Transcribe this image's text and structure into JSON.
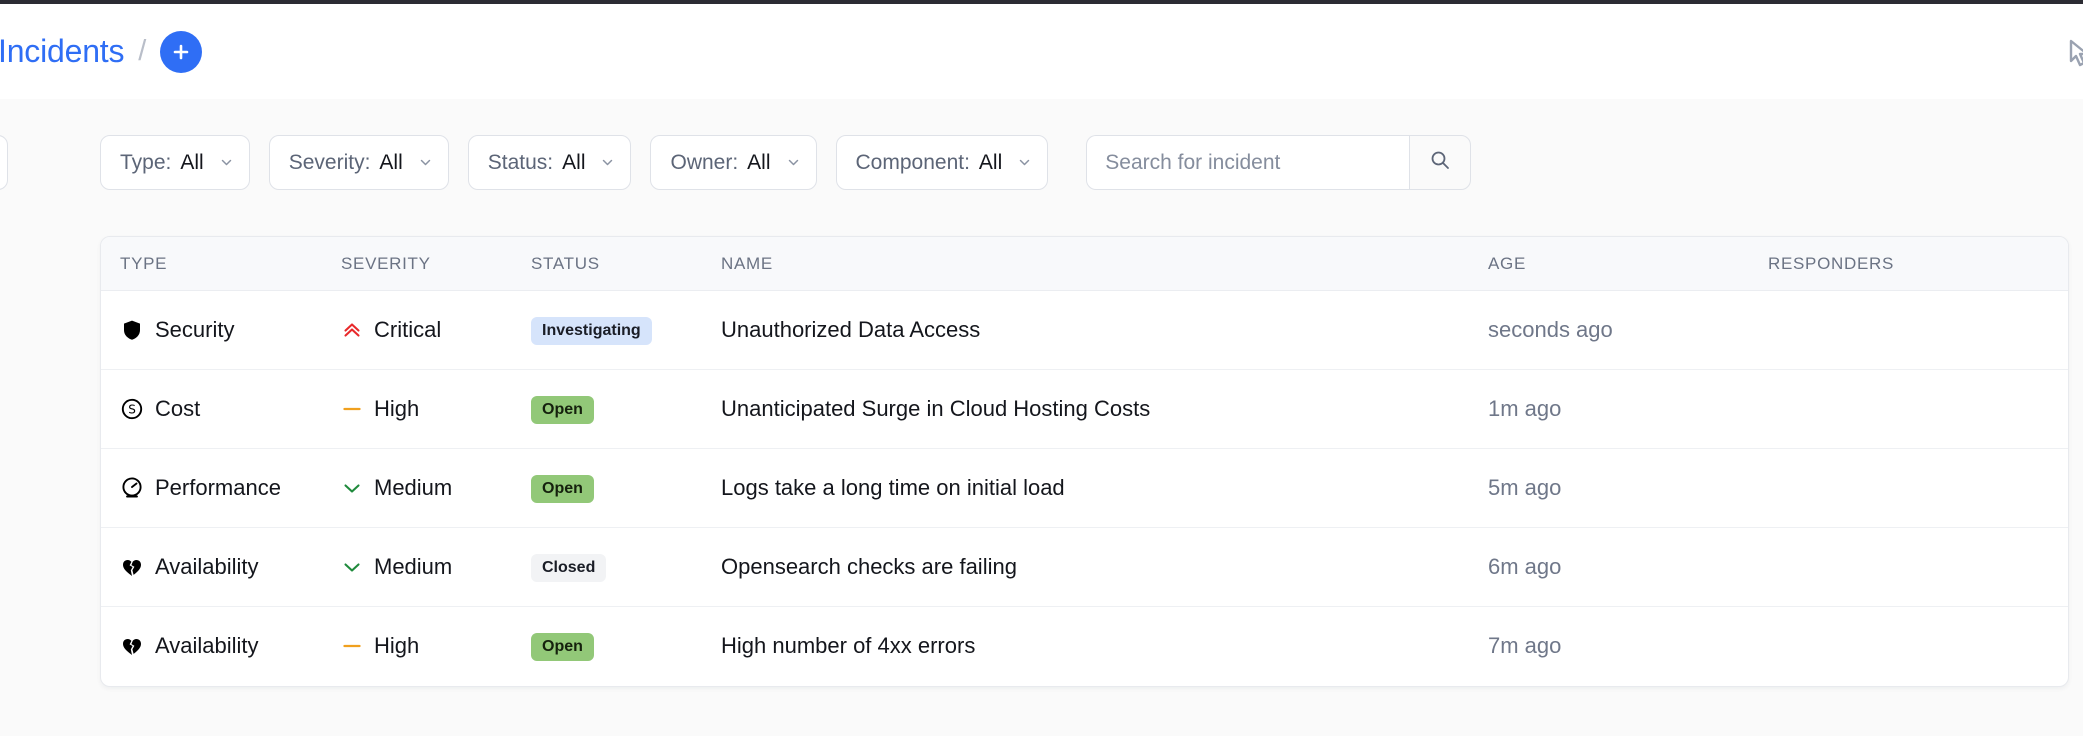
{
  "header": {
    "breadcrumb": {
      "root_label": "Incidents",
      "separator": "/"
    },
    "add_button_icon": "plus-icon",
    "right_icon": "cursor-icon"
  },
  "filters": [
    {
      "name": "type",
      "label": "Type:",
      "value": "All"
    },
    {
      "name": "severity",
      "label": "Severity:",
      "value": "All"
    },
    {
      "name": "status",
      "label": "Status:",
      "value": "All"
    },
    {
      "name": "owner",
      "label": "Owner:",
      "value": "All"
    },
    {
      "name": "component",
      "label": "Component:",
      "value": "All"
    }
  ],
  "search": {
    "placeholder": "Search for incident",
    "value": "",
    "button_icon": "search-icon"
  },
  "table": {
    "columns": [
      "TYPE",
      "SEVERITY",
      "STATUS",
      "NAME",
      "AGE",
      "RESPONDERS"
    ],
    "rows": [
      {
        "type": "Security",
        "type_icon": "shield-icon",
        "severity": "Critical",
        "severity_icon": "double-chevron-up-icon",
        "severity_color": "#e8292b",
        "status": "Investigating",
        "status_style": "investigating",
        "name": "Unauthorized Data Access",
        "age": "seconds ago",
        "responders": ""
      },
      {
        "type": "Cost",
        "type_icon": "dollar-circle-icon",
        "severity": "High",
        "severity_icon": "dash-icon",
        "severity_color": "#f0a01e",
        "status": "Open",
        "status_style": "open",
        "name": "Unanticipated Surge in Cloud Hosting Costs",
        "age": "1m ago",
        "responders": ""
      },
      {
        "type": "Performance",
        "type_icon": "gauge-icon",
        "severity": "Medium",
        "severity_icon": "chevron-down-icon",
        "severity_color": "#1f8a3c",
        "status": "Open",
        "status_style": "open",
        "name": "Logs take a long time on initial load",
        "age": "5m ago",
        "responders": ""
      },
      {
        "type": "Availability",
        "type_icon": "broken-heart-icon",
        "severity": "Medium",
        "severity_icon": "chevron-down-icon",
        "severity_color": "#1f8a3c",
        "status": "Closed",
        "status_style": "closed",
        "name": "Opensearch checks are failing",
        "age": "6m ago",
        "responders": ""
      },
      {
        "type": "Availability",
        "type_icon": "broken-heart-icon",
        "severity": "High",
        "severity_icon": "dash-icon",
        "severity_color": "#f0a01e",
        "status": "Open",
        "status_style": "open",
        "name": "High number of 4xx errors",
        "age": "7m ago",
        "responders": ""
      }
    ]
  },
  "colors": {
    "accent": "#2f6ef5",
    "critical": "#e8292b",
    "high": "#f0a01e",
    "medium": "#1f8a3c",
    "open_badge": "#92c878",
    "investigating_badge": "#d6e4fb",
    "closed_badge": "#f2f3f5"
  }
}
